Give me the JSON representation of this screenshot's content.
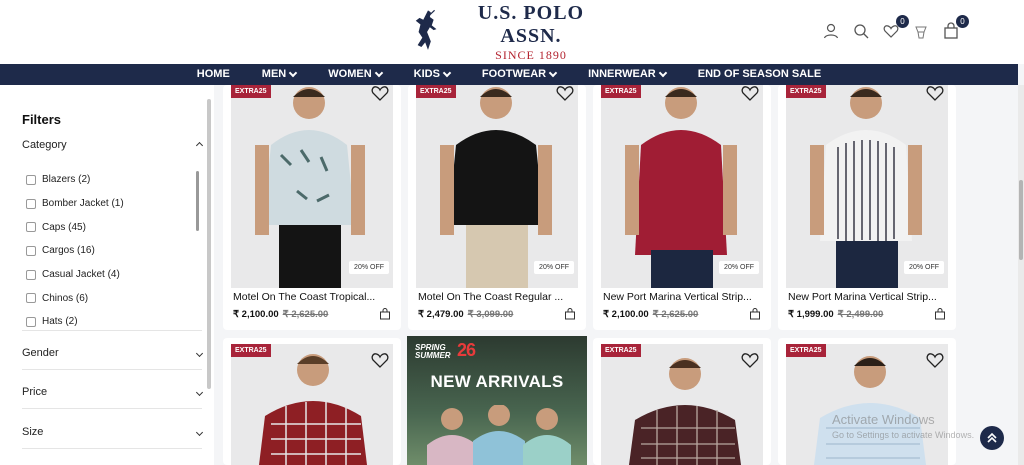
{
  "header": {
    "brand_name": "U.S. POLO ASSN.",
    "brand_since": "SINCE 1890",
    "wishlist_count": "0",
    "cart_count": "0",
    "icons": [
      "user-icon",
      "search-icon",
      "wishlist-icon",
      "gift-icon",
      "cart-icon"
    ]
  },
  "nav": {
    "items": [
      "HOME",
      "MEN",
      "WOMEN",
      "KIDS",
      "FOOTWEAR",
      "INNERWEAR",
      "END OF SEASON SALE"
    ]
  },
  "sidebar": {
    "title": "Filters",
    "category_label": "Category",
    "categories": [
      "Blazers (2)",
      "Bomber Jacket (1)",
      "Caps (45)",
      "Cargos (16)",
      "Casual Jacket (4)",
      "Chinos (6)",
      "Hats (2)"
    ],
    "sections": [
      "Gender",
      "Price",
      "Size"
    ]
  },
  "products": [
    {
      "tag": "EXTRA25",
      "discount": "20% OFF",
      "name": "Motel On The Coast Tropical...",
      "price": "₹ 2,100.00",
      "mrp": "₹ 2,625.00"
    },
    {
      "tag": "EXTRA25",
      "discount": "20% OFF",
      "name": "Motel On The Coast Regular ...",
      "price": "₹ 2,479.00",
      "mrp": "₹ 3,099.00"
    },
    {
      "tag": "EXTRA25",
      "discount": "20% OFF",
      "name": "New Port Marina Vertical Strip...",
      "price": "₹ 2,100.00",
      "mrp": "₹ 2,625.00"
    },
    {
      "tag": "EXTRA25",
      "discount": "20% OFF",
      "name": "New Port Marina Vertical Strip...",
      "price": "₹ 1,999.00",
      "mrp": "₹ 2,499.00"
    }
  ],
  "row2_tags": [
    "EXTRA25",
    "EXTRA25",
    "EXTRA25"
  ],
  "banner": {
    "season_line1": "SPRING",
    "season_line2": "SUMMER",
    "year": "26",
    "headline": "NEW ARRIVALS"
  },
  "watermark": {
    "line1": "Activate Windows",
    "line2": "Go to Settings to activate Windows."
  },
  "colors": {
    "navy": "#1e2a4a",
    "tag_red": "#a8243a",
    "brand_red": "#b3232f"
  }
}
